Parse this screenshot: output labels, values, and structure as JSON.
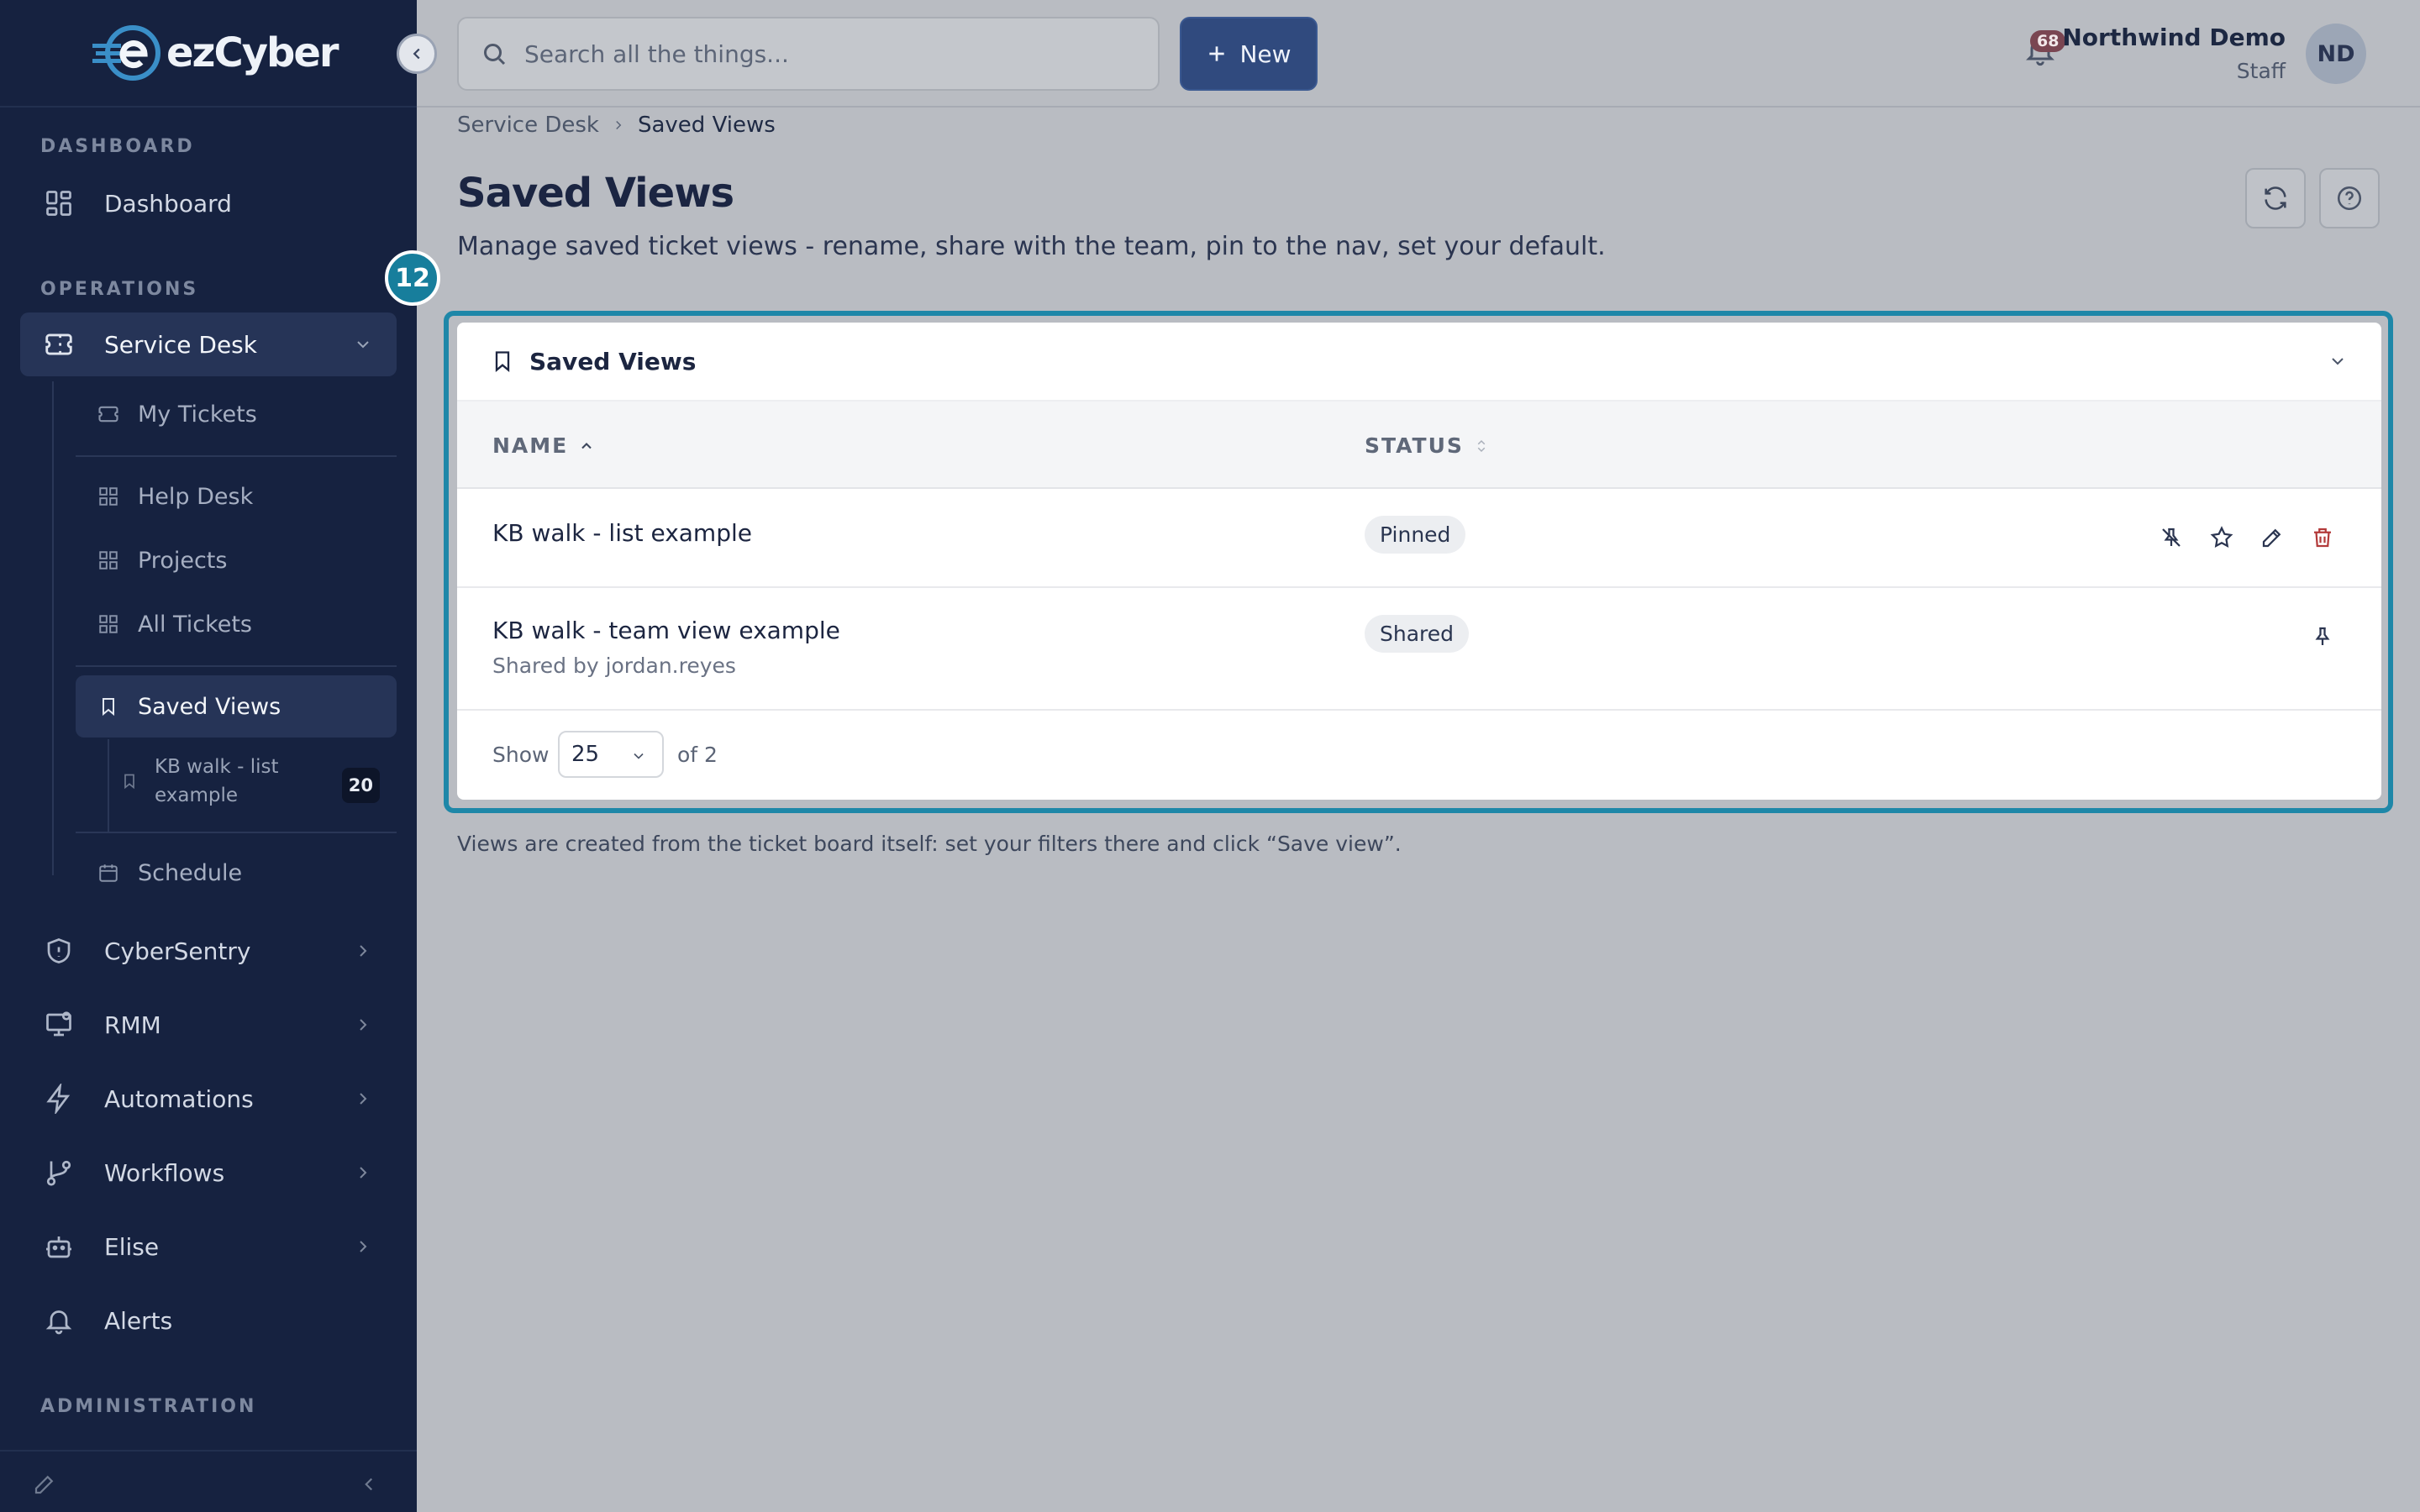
{
  "app": {
    "logo_text": "ezCyber"
  },
  "sidebar": {
    "sections": {
      "dashboard": "DASHBOARD",
      "operations": "OPERATIONS",
      "administration": "ADMINISTRATION"
    },
    "dashboard_item": "Dashboard",
    "service_desk": "Service Desk",
    "sub_items": {
      "my_tickets": "My Tickets",
      "help_desk": "Help Desk",
      "projects": "Projects",
      "all_tickets": "All Tickets",
      "saved_views": "Saved Views",
      "saved_view_child": "KB walk - list example",
      "saved_view_child_count": "20",
      "schedule": "Schedule"
    },
    "items": {
      "cybersentry": "CyberSentry",
      "rmm": "RMM",
      "automations": "Automations",
      "workflows": "Workflows",
      "elise": "Elise",
      "alerts": "Alerts"
    }
  },
  "topbar": {
    "search_placeholder": "Search all the things...",
    "new_label": "New",
    "notifications_count": "68",
    "user_name": "Northwind Demo",
    "user_role": "Staff",
    "avatar_initials": "ND"
  },
  "breadcrumb": {
    "parent": "Service Desk",
    "current": "Saved Views"
  },
  "page": {
    "title": "Saved Views",
    "subtitle": "Manage saved ticket views - rename, share with the team, pin to the nav, set your default.",
    "step_badge": "12",
    "hint": "Views are created from the ticket board itself: set your filters there and click “Save view”."
  },
  "card": {
    "title": "Saved Views",
    "columns": {
      "name": "NAME",
      "status": "STATUS"
    },
    "rows": [
      {
        "name": "KB walk - list example",
        "status": "Pinned",
        "sub": ""
      },
      {
        "name": "KB walk - team view example",
        "status": "Shared",
        "sub": "Shared by jordan.reyes"
      }
    ],
    "footer": {
      "show": "Show",
      "page_size": "25",
      "total": "of 2"
    }
  },
  "colors": {
    "sidebar_bg": "#162240",
    "accent": "#1e87a8",
    "primary_button": "#304a7e",
    "delete": "#b23a3a"
  }
}
